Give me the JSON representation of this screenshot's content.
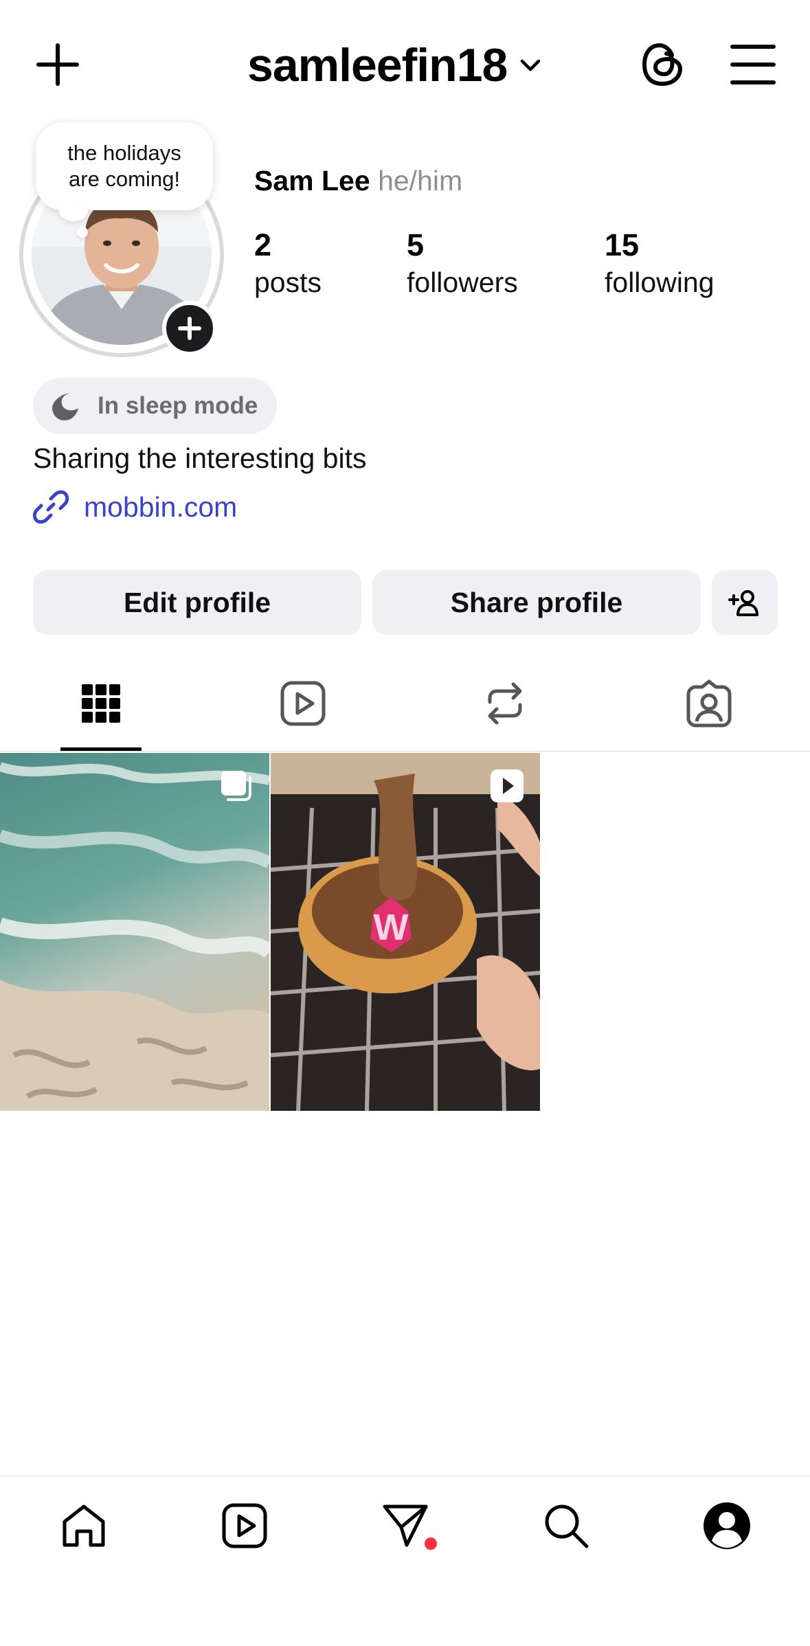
{
  "header": {
    "username": "samleefin18",
    "icons": [
      "plus-icon",
      "chevron-down-icon",
      "threads-icon",
      "menu-icon"
    ]
  },
  "profile": {
    "note": "the holidays\nare coming!",
    "name": "Sam Lee",
    "pronouns": "he/him",
    "stats": {
      "posts": {
        "value": "2",
        "label": "posts"
      },
      "followers": {
        "value": "5",
        "label": "followers"
      },
      "following": {
        "value": "15",
        "label": "following"
      }
    },
    "status": "In sleep mode",
    "bio": "Sharing the interesting bits",
    "link": "mobbin.com"
  },
  "actions": {
    "edit": "Edit profile",
    "share": "Share profile"
  },
  "tabs": [
    "posts-grid-tab",
    "reels-tab",
    "reposts-tab",
    "tagged-tab"
  ],
  "posts": [
    {
      "type": "carousel",
      "icon": "multiple-icon"
    },
    {
      "type": "reel",
      "icon": "play-icon"
    }
  ],
  "bottom_nav": [
    "home",
    "reels",
    "messages",
    "search",
    "profile"
  ],
  "colors": {
    "link": "#3943c9",
    "pill_bg": "#efeff4",
    "notification_dot": "#ff3040"
  }
}
